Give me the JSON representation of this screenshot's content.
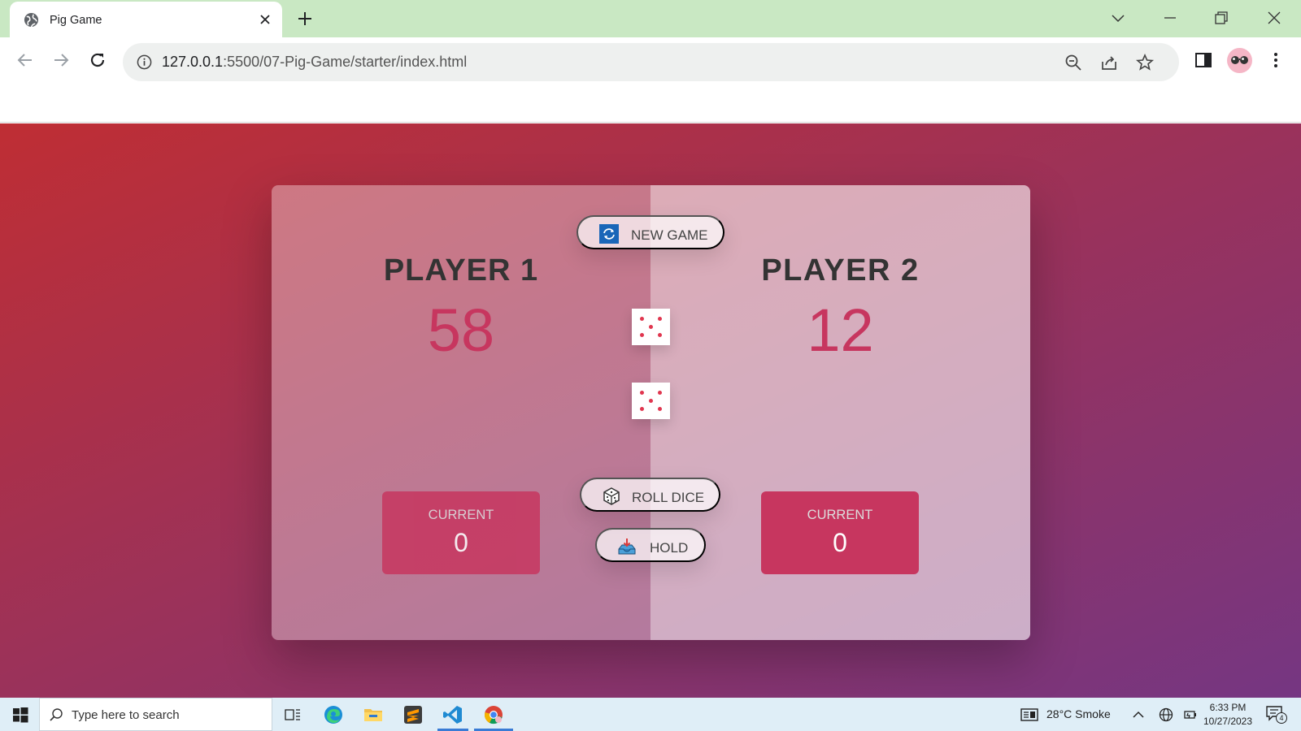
{
  "browser": {
    "tab_title": "Pig Game",
    "url_host": "127.0.0.1",
    "url_rest": ":5500/07-Pig-Game/starter/index.html"
  },
  "game": {
    "new_game_label": "New game",
    "roll_dice_label": "Roll dice",
    "hold_label": "Hold",
    "dice_values": [
      5,
      5
    ],
    "players": [
      {
        "name": "Player 1",
        "score": "58",
        "current_label": "Current",
        "current_score": "0"
      },
      {
        "name": "Player 2",
        "score": "12",
        "current_label": "Current",
        "current_score": "0"
      }
    ]
  },
  "taskbar": {
    "search_placeholder": "Type here to search",
    "weather": "28°C  Smoke",
    "time": "6:33 PM",
    "date": "10/27/2023",
    "notification_count": "4"
  },
  "colors": {
    "accent": "#c7365f",
    "page_gradient_start": "#bf2e34",
    "page_gradient_end": "#753682",
    "tab_strip": "#c9e8c3"
  }
}
